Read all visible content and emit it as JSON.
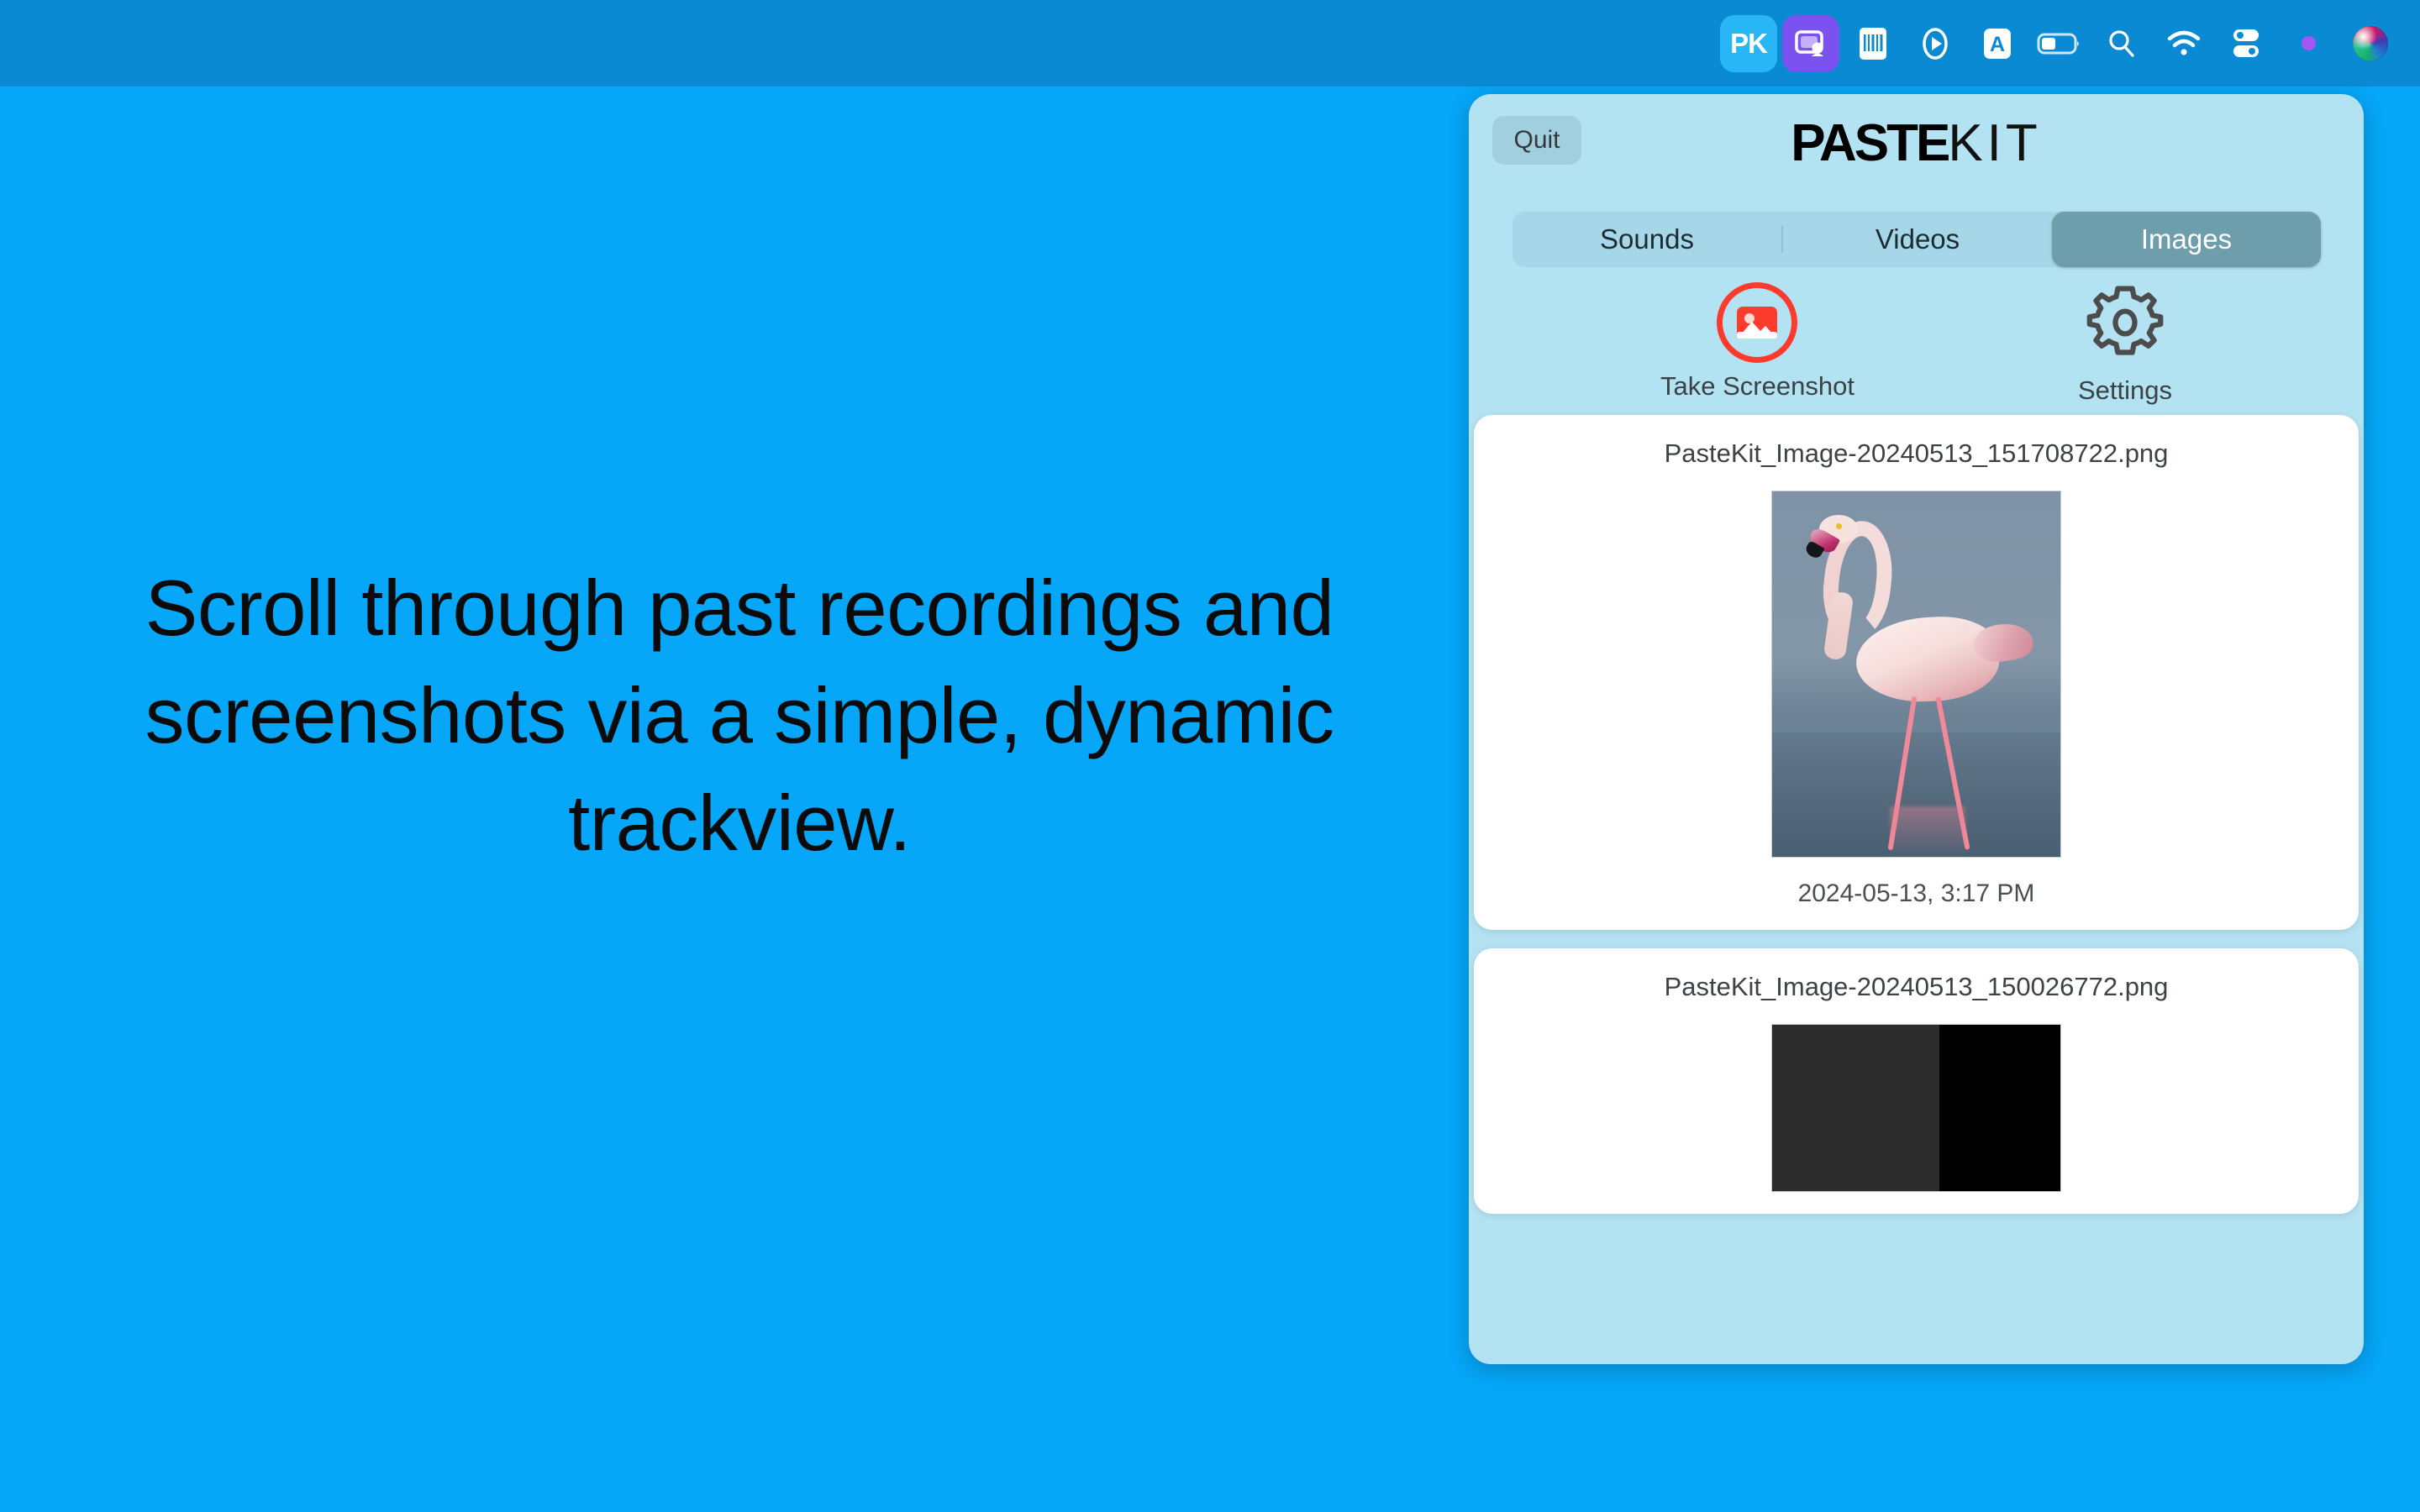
{
  "desktop": {
    "background_color": "#06a6f8",
    "headline": "Scroll through past recordings and screenshots via a simple, dynamic trackview."
  },
  "menubar": {
    "background_color": "#0b8ad4",
    "items": [
      {
        "name": "pastekit-menubar-icon",
        "label": "PK",
        "tile_color": "#29b6f6"
      },
      {
        "name": "screen-share-icon",
        "label": "",
        "tile_color": "#7b51ef"
      },
      {
        "name": "barcode-icon",
        "label": ""
      },
      {
        "name": "play-circle-icon",
        "label": ""
      },
      {
        "name": "text-input-icon",
        "label": "A"
      },
      {
        "name": "battery-icon",
        "label": ""
      },
      {
        "name": "search-icon",
        "label": ""
      },
      {
        "name": "wifi-icon",
        "label": ""
      },
      {
        "name": "control-center-icon",
        "label": ""
      },
      {
        "name": "recording-dot",
        "label": "",
        "color": "#a855f7"
      },
      {
        "name": "siri-orb-icon",
        "label": ""
      }
    ]
  },
  "panel": {
    "background_color": "#b3e2f2",
    "quit_label": "Quit",
    "brand_bold": "PASTE",
    "brand_thin": "KIT",
    "tabs": [
      {
        "label": "Sounds",
        "selected": false
      },
      {
        "label": "Videos",
        "selected": false
      },
      {
        "label": "Images",
        "selected": true
      }
    ],
    "selected_tab_color": "#6e9dab",
    "actions": [
      {
        "name": "take-screenshot-button",
        "label": "Take Screenshot",
        "icon": "image-in-circle-icon",
        "accent": "#fd3b2d"
      },
      {
        "name": "settings-button",
        "label": "Settings",
        "icon": "gear-icon",
        "accent": "#4c4c4c"
      }
    ],
    "items": [
      {
        "filename": "PasteKit_Image-20240513_151708722.png",
        "timestamp": "2024-05-13, 3:17 PM",
        "thumbnail": "flamingo-photo"
      },
      {
        "filename": "PasteKit_Image-20240513_150026772.png",
        "timestamp": "",
        "thumbnail": "dark-screenshot"
      }
    ]
  }
}
